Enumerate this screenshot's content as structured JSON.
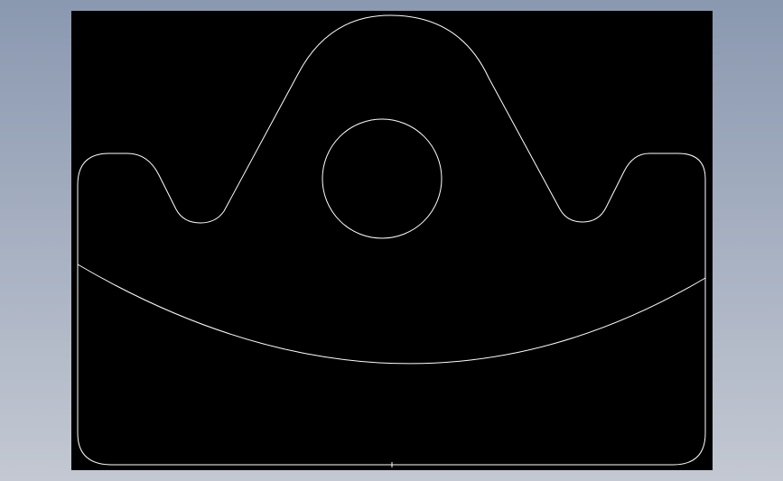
{
  "colors": {
    "backdrop_top": "#8a98b0",
    "backdrop_bottom": "#c3c8d2",
    "canvas_background": "#000000",
    "line_color": "#ffffff"
  },
  "drawing": {
    "entities": [
      "outer-profile",
      "center-hole",
      "sweep-arc",
      "origin-tick"
    ]
  }
}
